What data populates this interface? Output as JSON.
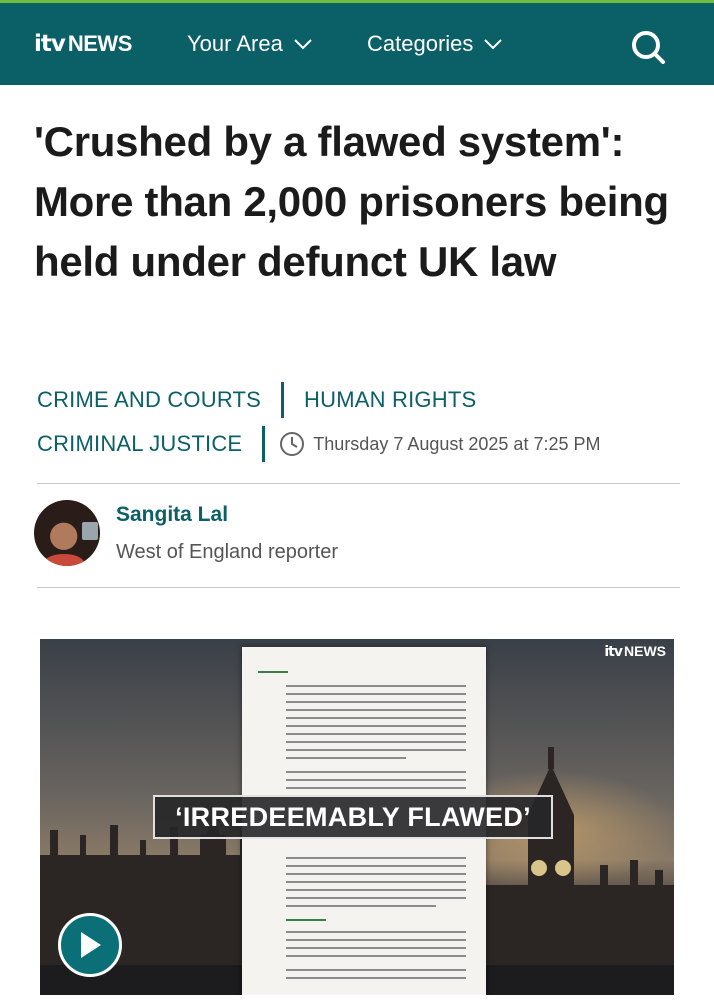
{
  "header": {
    "logo_itv": "itv",
    "logo_news": "NEWS",
    "nav": [
      {
        "label": "Your Area"
      },
      {
        "label": "Categories"
      }
    ],
    "search_icon": "search-icon"
  },
  "article": {
    "headline": "'Crushed by a flawed system': More than 2,000 prisoners being held under defunct UK law",
    "tags": [
      "CRIME AND COURTS",
      "HUMAN RIGHTS",
      "CRIMINAL JUSTICE"
    ],
    "date": "Thursday 7 August 2025 at 7:25 PM"
  },
  "author": {
    "name": "Sangita Lal",
    "role": "West of England reporter"
  },
  "media": {
    "logo_itv": "itv",
    "logo_news": "NEWS",
    "banner": "‘IRREDEEMABLY FLAWED’",
    "play_icon": "play-icon"
  },
  "colors": {
    "brand": "#0b5f67",
    "accent_line": "#6fbf3e"
  }
}
